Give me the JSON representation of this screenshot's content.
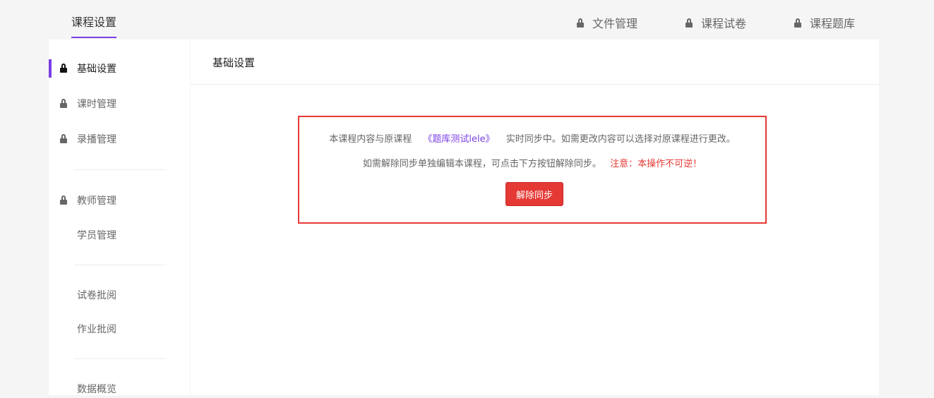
{
  "topbar": {
    "active_tab": "课程设置",
    "right_links": [
      {
        "label": "文件管理",
        "icon": "lock-icon"
      },
      {
        "label": "课程试卷",
        "icon": "lock-icon"
      },
      {
        "label": "课程题库",
        "icon": "lock-icon"
      }
    ]
  },
  "sidebar": {
    "items": [
      {
        "label": "基础设置",
        "locked": true,
        "active": true
      },
      {
        "label": "课时管理",
        "locked": true
      },
      {
        "label": "录播管理",
        "locked": true
      },
      {
        "label": "教师管理",
        "locked": true
      },
      {
        "label": "学员管理",
        "locked": false
      },
      {
        "label": "试卷批阅",
        "locked": false
      },
      {
        "label": "作业批阅",
        "locked": false
      },
      {
        "label": "数据概览",
        "locked": false
      }
    ]
  },
  "main": {
    "title": "基础设置",
    "sync": {
      "line1_prefix": "本课程内容与原课程",
      "course_name": "《题库测试lele》",
      "line1_suffix": "实时同步中。如需更改内容可以选择对原课程进行更改。",
      "line2": "如需解除同步单独编辑本课程，可点击下方按钮解除同步。",
      "warning": "注意：本操作不可逆！",
      "button_label": "解除同步"
    }
  },
  "colors": {
    "accent": "#7b3fe4",
    "danger": "#e53935",
    "page_bg": "#f5f5f5"
  }
}
